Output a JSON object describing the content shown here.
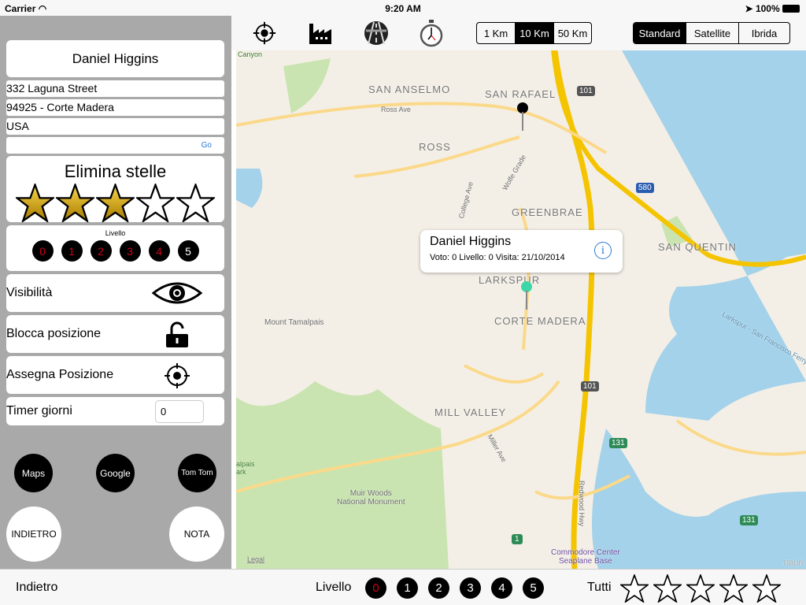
{
  "status_bar": {
    "carrier": "Carrier",
    "time": "9:20 AM",
    "battery": "100%"
  },
  "contact": {
    "name": "Daniel Higgins",
    "street": "332 Laguna Street",
    "city": "94925 - Corte Madera",
    "country": "USA",
    "go_label": "Go"
  },
  "stars_panel": {
    "title": "Elimina stelle",
    "rating": 3,
    "max": 5
  },
  "level_panel": {
    "label": "Livello",
    "levels": [
      "0",
      "1",
      "2",
      "3",
      "4",
      "5"
    ],
    "level_colors": [
      "#d0021b",
      "#d0021b",
      "#d0021b",
      "#d0021b",
      "#d0021b",
      "#ffffff"
    ]
  },
  "options": {
    "visibility": "Visibilità",
    "lock": "Blocca posizione",
    "assign": "Assegna Posizione",
    "timer": "Timer giorni",
    "timer_value": "0"
  },
  "nav_buttons": {
    "maps": "Maps",
    "google": "Google",
    "tomtom": "Tom Tom",
    "back": "INDIETRO",
    "note": "NOTA"
  },
  "toolbar": {
    "icons": [
      "target-icon",
      "factory-icon",
      "highway-icon",
      "stopwatch-icon"
    ],
    "distance": {
      "options": [
        "1 Km",
        "10 Km",
        "50 Km"
      ],
      "selected": "10 Km"
    },
    "map_type": {
      "options": [
        "Standard",
        "Satellite",
        "Ibrida"
      ],
      "selected": "Standard"
    }
  },
  "map": {
    "labels": {
      "san_anselmo": "SAN ANSELMO",
      "san_rafael": "SAN RAFAEL",
      "ross": "ROSS",
      "greenbrae": "GREENBRAE",
      "san_quentin": "SAN QUENTIN",
      "larkspur": "LARKSPUR",
      "corte_madera": "CORTE MADERA",
      "mill_valley": "MILL VALLEY",
      "mount_tamalpais": "Mount Tamalpais",
      "muir_woods": "Muir Woods\nNational Monument",
      "seaplane": "Commodore Center\nSeaplane Base",
      "canyon": "Canyon",
      "ross_ave": "Ross Ave",
      "college_ave": "College Ave",
      "wolfe_grade": "Wolfe Grade",
      "miller_ave": "Miller Ave",
      "redwood_hwy": "Redwood Hwy",
      "ferry": "Larkspur - San Francisco Ferry",
      "tamalpais_park": "alpais\nark",
      "legal": "Legal",
      "tiburon": "TIBUR"
    },
    "shields": {
      "us101": "101",
      "i580": "580",
      "ca131": "131",
      "ca1": "1"
    },
    "callout": {
      "title": "Daniel Higgins",
      "subtitle": "Voto: 0 Livello: 0 Visita: 21/10/2014"
    },
    "colors": {
      "land": "#f4efe6",
      "park": "#c9e4b0",
      "water": "#a4d2ea",
      "highway": "#f5c400",
      "road": "#fbd98a"
    }
  },
  "bottom_bar": {
    "back": "Indietro",
    "level_label": "Livello",
    "levels": [
      "0",
      "1",
      "2",
      "3",
      "4",
      "5"
    ],
    "selected_level": "0",
    "all_label": "Tutti",
    "stars": 5
  }
}
